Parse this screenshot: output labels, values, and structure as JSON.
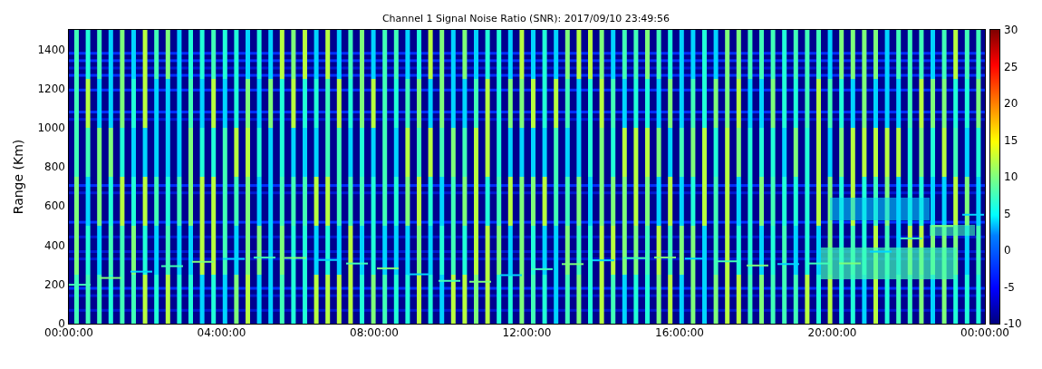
{
  "title": "Channel 1 Signal Noise Ratio (SNR): 2017/09/10 23:49:56",
  "y_axis": {
    "label": "Range (Km)",
    "ticks": [
      "1400",
      "1200",
      "1000",
      "800",
      "600",
      "400",
      "200",
      "0"
    ]
  },
  "x_axis": {
    "ticks": [
      "00:00:00",
      "04:00:00",
      "08:00:00",
      "12:00:00",
      "16:00:00",
      "20:00:00",
      "00:00:00"
    ]
  },
  "colorbar": {
    "ticks": [
      "30",
      "25",
      "20",
      "15",
      "10",
      "5",
      "0",
      "-5",
      "-10"
    ]
  }
}
